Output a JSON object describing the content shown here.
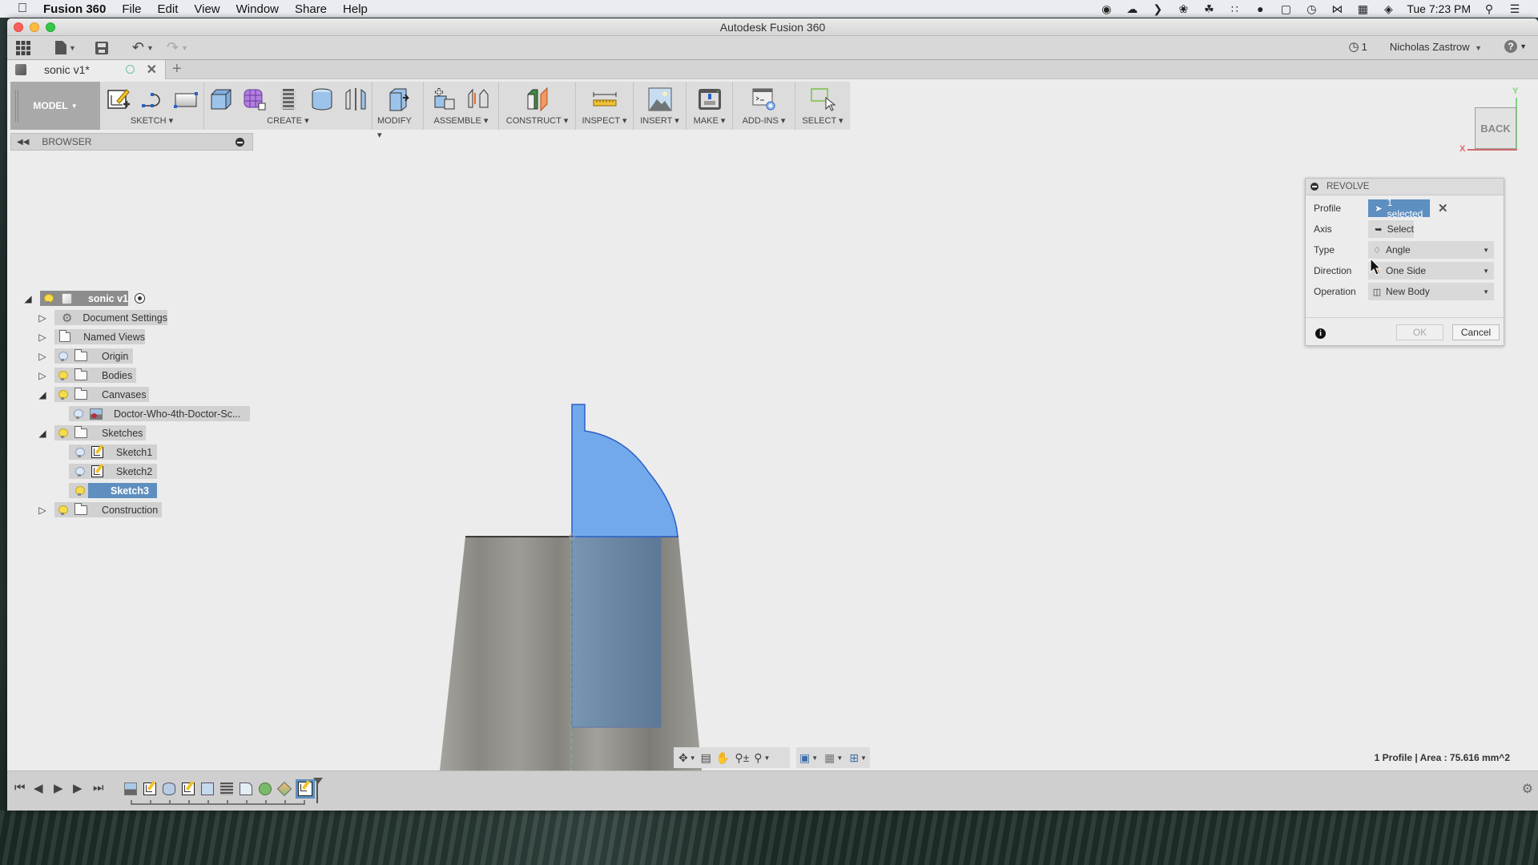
{
  "menubar": {
    "app_name": "Fusion 360",
    "items": [
      "File",
      "Edit",
      "View",
      "Window",
      "Share",
      "Help"
    ],
    "clock": "Tue 7:23 PM",
    "status_icons": [
      "record-icon",
      "cloud-upload-icon",
      "chevron-right-icon",
      "creative-cloud-icon",
      "ghost-icon",
      "dots-icon",
      "bubble-icon",
      "display-icon",
      "time-machine-icon",
      "bluetooth-icon",
      "calendar-icon",
      "wifi-icon",
      "spotlight-icon",
      "notification-icon"
    ]
  },
  "window": {
    "title": "Autodesk Fusion 360"
  },
  "qat": {
    "job_count": "1",
    "user": "Nicholas Zastrow",
    "help": "?"
  },
  "tab": {
    "name": "sonic v1*",
    "new_tab": "+"
  },
  "toolbar": {
    "workspace": "MODEL",
    "groups": [
      {
        "label": "SKETCH",
        "icons": [
          "create-sketch-icon",
          "spline-icon",
          "rectangle-icon"
        ]
      },
      {
        "label": "CREATE",
        "icons": [
          "box-icon",
          "t-spline-form-icon",
          "coil-icon",
          "cylinder-icon",
          "mirror-icon"
        ]
      },
      {
        "label": "MODIFY",
        "icons": [
          "press-pull-icon"
        ]
      },
      {
        "label": "ASSEMBLE",
        "icons": [
          "new-component-icon",
          "joint-icon"
        ]
      },
      {
        "label": "CONSTRUCT",
        "icons": [
          "offset-plane-icon"
        ]
      },
      {
        "label": "INSPECT",
        "icons": [
          "measure-icon"
        ]
      },
      {
        "label": "INSERT",
        "icons": [
          "insert-image-icon"
        ]
      },
      {
        "label": "MAKE",
        "icons": [
          "3d-print-icon"
        ]
      },
      {
        "label": "ADD-INS",
        "icons": [
          "scripts-icon"
        ]
      },
      {
        "label": "SELECT",
        "icons": [
          "select-box-icon"
        ]
      }
    ]
  },
  "browser": {
    "title": "BROWSER",
    "root": "sonic v1",
    "items": [
      {
        "label": "Document Settings",
        "expanded": false
      },
      {
        "label": "Named Views",
        "expanded": false
      },
      {
        "label": "Origin",
        "expanded": false,
        "visible": false
      },
      {
        "label": "Bodies",
        "expanded": false,
        "visible": true
      },
      {
        "label": "Canvases",
        "expanded": true,
        "visible": true
      },
      {
        "label": "Doctor-Who-4th-Doctor-Sc...",
        "visible": false
      },
      {
        "label": "Sketches",
        "expanded": true,
        "visible": true
      },
      {
        "label": "Sketch1",
        "visible": false
      },
      {
        "label": "Sketch2",
        "visible": false
      },
      {
        "label": "Sketch3",
        "visible": true,
        "selected": true
      },
      {
        "label": "Construction",
        "expanded": false,
        "visible": true
      }
    ]
  },
  "viewcube": {
    "face": "BACK",
    "x_label": "X",
    "y_label": "Y"
  },
  "revolve": {
    "title": "REVOLVE",
    "rows": [
      {
        "label": "Profile",
        "value": "1 selected"
      },
      {
        "label": "Axis",
        "value": "Select"
      },
      {
        "label": "Type",
        "value": "Angle"
      },
      {
        "label": "Direction",
        "value": "One Side"
      },
      {
        "label": "Operation",
        "value": "New Body"
      }
    ],
    "ok": "OK",
    "cancel": "Cancel"
  },
  "status": {
    "text": "1 Profile | Area : 75.616 mm^2"
  },
  "colors": {
    "profile_fill": "#72a9eb",
    "profile_edge": "#2b5fc8",
    "selection": "#5d8fc0",
    "body": "#8e8c86"
  },
  "timeline": {
    "features": [
      "canvas-feature-icon",
      "sketch-feature-icon",
      "revolve-feature-icon",
      "sketch-feature-icon",
      "extrude-feature-icon",
      "coil-feature-icon",
      "fillet-feature-icon",
      "sweep-feature-icon",
      "loft-feature-icon",
      "sketch-feature-icon"
    ]
  }
}
